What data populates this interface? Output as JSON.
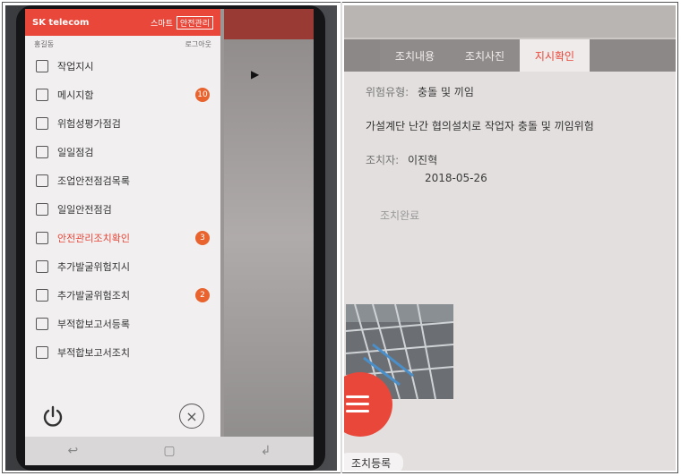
{
  "left": {
    "brand": "SK telecom",
    "header_right_label": "스마트",
    "header_box_label": "안전관리",
    "user": {
      "name": "홍길동",
      "status": "로그아웃"
    },
    "menu": [
      {
        "label": "작업지시",
        "badge": "",
        "active": false,
        "icon": "clipboard-icon"
      },
      {
        "label": "메시지함",
        "badge": "10",
        "active": false,
        "icon": "phone-icon"
      },
      {
        "label": "위험성평가점검",
        "badge": "",
        "active": false,
        "icon": "calendar-icon"
      },
      {
        "label": "일일점검",
        "badge": "",
        "active": false,
        "icon": "checklist-icon"
      },
      {
        "label": "조업안전점검목록",
        "badge": "",
        "active": false,
        "icon": "list-icon"
      },
      {
        "label": "일일안전점검",
        "badge": "",
        "active": false,
        "icon": "shield-icon"
      },
      {
        "label": "안전관리조치확인",
        "badge": "3",
        "active": true,
        "icon": "alert-icon"
      },
      {
        "label": "추가발굴위험지시",
        "badge": "",
        "active": false,
        "icon": "edit-icon"
      },
      {
        "label": "추가발굴위험조치",
        "badge": "2",
        "active": false,
        "icon": "chat-icon"
      },
      {
        "label": "부적합보고서등록",
        "badge": "",
        "active": false,
        "icon": "pencil-icon"
      },
      {
        "label": "부적합보고서조치",
        "badge": "",
        "active": false,
        "icon": "checkbox-icon"
      }
    ],
    "footer": {
      "power_icon": "power-icon",
      "close_icon": "close-circle-icon",
      "close_glyph": "×"
    },
    "navbar": {
      "back": "↩",
      "home": "▢",
      "recent": "↲"
    }
  },
  "right": {
    "tabs": [
      {
        "label": "조치내용",
        "active": false
      },
      {
        "label": "조치사진",
        "active": false
      },
      {
        "label": "지시확인",
        "active": true
      }
    ],
    "risk_type_label": "위험유형:",
    "risk_type_value": "충돌 및 끼임",
    "description": "가설계단 난간 협의설치로 작업자 충돌 및 끼임위험",
    "inspector_label": "조치자:",
    "inspector_value": "이진혁",
    "date_value": "2018-05-26",
    "note_value": "조치완료",
    "bottom_button": "조치등록"
  },
  "colors": {
    "accent": "#e8473a",
    "badge": "#e8632e"
  }
}
